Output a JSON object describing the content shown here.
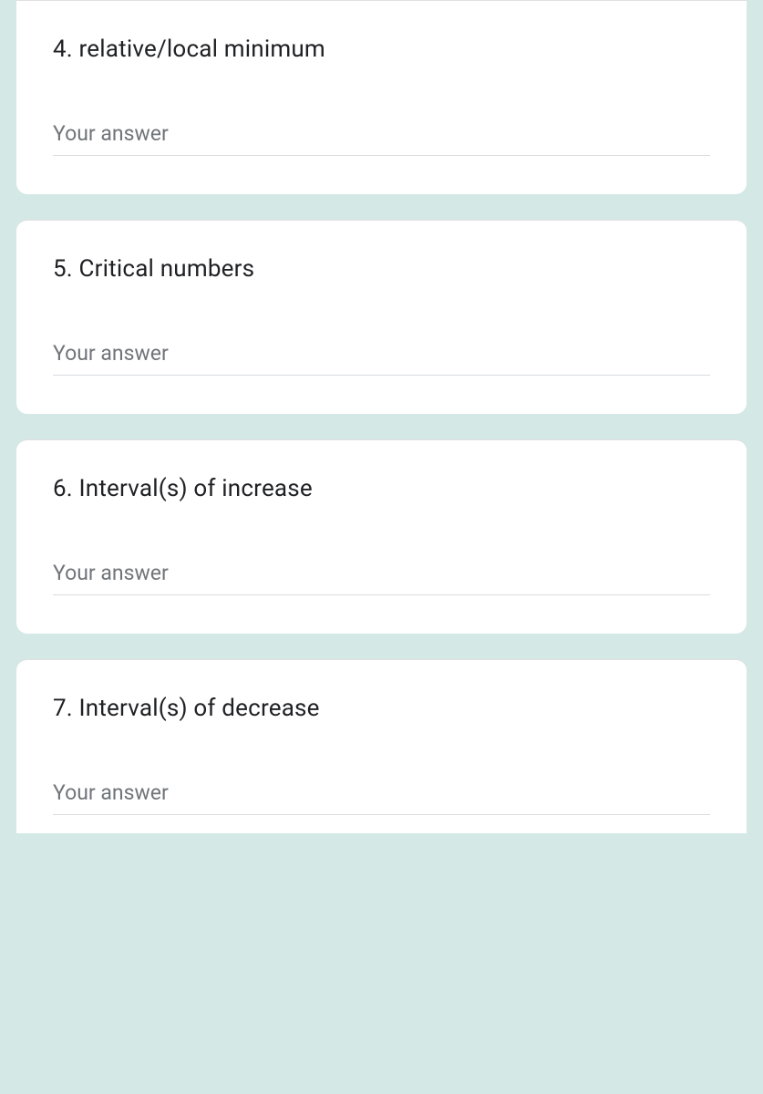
{
  "questions": [
    {
      "title": "4. relative/local minimum",
      "placeholder": "Your answer"
    },
    {
      "title": "5. Critical numbers",
      "placeholder": "Your answer"
    },
    {
      "title": "6. Interval(s) of increase",
      "placeholder": "Your answer"
    },
    {
      "title": "7. Interval(s) of decrease",
      "placeholder": "Your answer"
    }
  ]
}
